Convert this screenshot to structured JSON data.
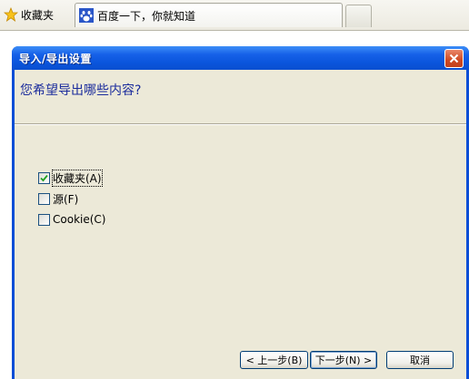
{
  "browser": {
    "favorites_label": "收藏夹",
    "tab_title": "百度一下，你就知道",
    "icons": {
      "favorites": "star-icon",
      "tab": "baidu-paw-icon",
      "new_tab": "new-tab"
    }
  },
  "dialog": {
    "title": "导入/导出设置",
    "question": "您希望导出哪些内容?",
    "options": [
      {
        "label": "收藏夹(A)",
        "checked": true
      },
      {
        "label": "源(F)",
        "checked": false
      },
      {
        "label": "Cookie(C)",
        "checked": false
      }
    ],
    "buttons": {
      "back": "< 上一步(B)",
      "next": "下一步(N) >",
      "cancel": "取消"
    },
    "colors": {
      "titlebar": "#0a55dc",
      "background": "#ece9d8",
      "question_text": "#1b2c9c",
      "close_button": "#cf4a22"
    }
  }
}
